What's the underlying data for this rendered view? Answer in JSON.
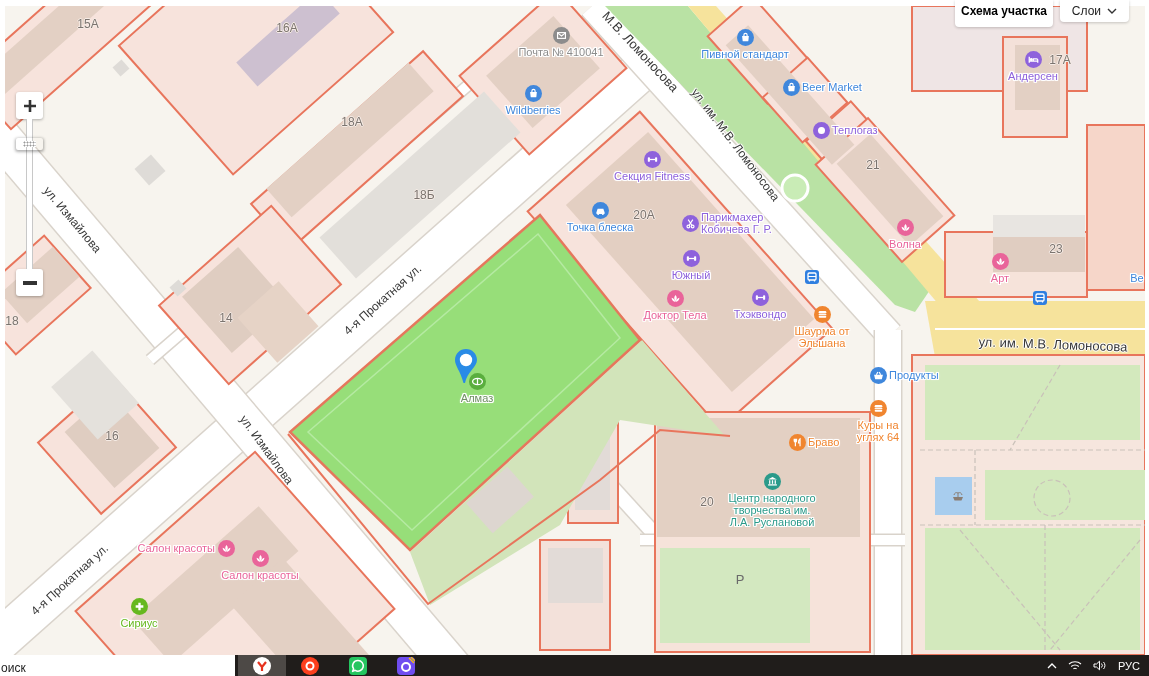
{
  "map": {
    "streets": [
      "М.В. Ломоносова",
      "ул. им. М.В. Ломоносова",
      "ул. Измайлова",
      "4-я Прокатная ул.",
      "ул. им. М.В. Ломоносова",
      "ул. Измайлова",
      "4-я Прокатная ул."
    ],
    "house_numbers": [
      "15А",
      "16А",
      "17А",
      "18А",
      "21",
      "18Б",
      "20А",
      "23",
      "14",
      "18",
      "16",
      "20"
    ],
    "parking_label": "P",
    "places": [
      {
        "name": "Почта № 410041",
        "kind": "mail",
        "color": "#8c8c8c",
        "selected": false
      },
      {
        "name": "Пивной стандарт",
        "kind": "shop",
        "color": "#3f87dc",
        "selected": false
      },
      {
        "name": "Андерсен",
        "kind": "hotel",
        "color": "#8e62dc",
        "selected": false
      },
      {
        "name": "Beer Market",
        "kind": "shop",
        "color": "#3f87dc",
        "selected": false
      },
      {
        "name": "Wildberries",
        "kind": "shop",
        "color": "#3f87dc",
        "selected": false
      },
      {
        "name": "Теплогаз",
        "kind": "ring",
        "color": "#8e62dc",
        "selected": false
      },
      {
        "name": "Секция Fitness",
        "kind": "fitness",
        "color": "#8e62dc",
        "selected": false
      },
      {
        "name": "Точка блеска",
        "kind": "car",
        "color": "#3f87dc",
        "selected": false
      },
      {
        "name": "Парикмахер\nКобичева Г. Р.",
        "kind": "barber",
        "color": "#8e62dc",
        "selected": false
      },
      {
        "name": "Волна",
        "kind": "beauty",
        "color": "#e9649a",
        "selected": false
      },
      {
        "name": "Южный",
        "kind": "fitness",
        "color": "#8e62dc",
        "selected": false
      },
      {
        "name": "Арт",
        "kind": "beauty",
        "color": "#e9649a",
        "selected": false
      },
      {
        "name": "Ве",
        "kind": "label",
        "color": "#3f87dc",
        "selected": false
      },
      {
        "name": "Тхэквондо",
        "kind": "fitness",
        "color": "#8e62dc",
        "selected": false
      },
      {
        "name": "Доктор Тела",
        "kind": "beauty",
        "color": "#e9649a",
        "selected": false
      },
      {
        "name": "Шаурма от\nЭльшана",
        "kind": "fastfood",
        "color": "#f0852f",
        "selected": false
      },
      {
        "name": "Продукты",
        "kind": "grocery",
        "color": "#3f87dc",
        "selected": false
      },
      {
        "name": "Алмаз",
        "kind": "stadium",
        "color": "#5aae3e",
        "selected": true
      },
      {
        "name": "Куры на\nуглях 64",
        "kind": "fastfood",
        "color": "#f0852f",
        "selected": false
      },
      {
        "name": "Браво",
        "kind": "restaurant",
        "color": "#f0852f",
        "selected": false
      },
      {
        "name": "Центр народного\nтворчества им.\nЛ.А. Руслановой",
        "kind": "museum",
        "color": "#2a9a8a",
        "selected": false
      },
      {
        "name": "Салон красоты",
        "kind": "beauty",
        "color": "#e9649a",
        "selected": false
      },
      {
        "name": "Салон красоты",
        "kind": "beauty",
        "color": "#e9649a",
        "selected": false
      },
      {
        "name": "Сириус",
        "kind": "pharmacy",
        "color": "#66b81f",
        "selected": false
      }
    ],
    "zoom_slider": {
      "level": 0.87
    }
  },
  "map_buttons": [
    {
      "label": "Схема участка",
      "kind": "plain"
    },
    {
      "label": "Слои",
      "kind": "dropdown"
    }
  ],
  "taskbar": {
    "search": {
      "placeholder": "оиск"
    },
    "apps": [
      {
        "kind": "browser",
        "selected": true
      },
      {
        "kind": "yandex",
        "selected": false
      },
      {
        "kind": "messenger",
        "selected": false
      },
      {
        "kind": "app",
        "selected": false
      }
    ],
    "language": "РУС"
  }
}
